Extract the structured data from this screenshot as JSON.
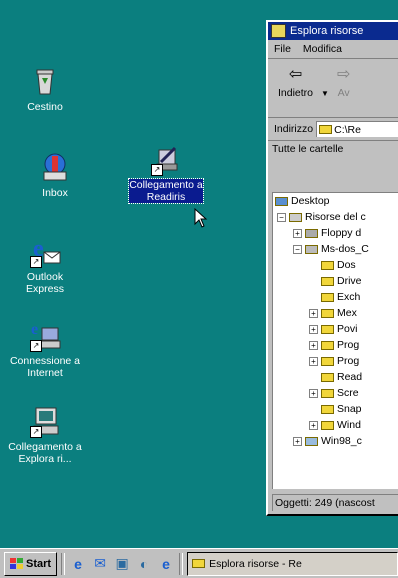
{
  "desktop": {
    "icons": [
      {
        "label": "Cestino"
      },
      {
        "label": "Inbox"
      },
      {
        "label": "Outlook Express"
      },
      {
        "label": "Connessione a Internet"
      },
      {
        "label": "Collegamento a Explora ri..."
      },
      {
        "label": "Collegamento a Readiris"
      }
    ]
  },
  "explorer": {
    "title": "Esplora risorse",
    "menu": [
      "File",
      "Modifica"
    ],
    "toolbar": {
      "back": "Indietro",
      "forward": "Av"
    },
    "address": {
      "label": "Indirizzo",
      "value": "C:\\Re"
    },
    "pane_header": "Tutte le cartelle",
    "tree": [
      "Desktop",
      "Risorse del c",
      "Floppy d",
      "Ms-dos_C",
      "Dos",
      "Drive",
      "Exch",
      "Mex",
      "Povi",
      "Prog",
      "Prog",
      "Read",
      "Scre",
      "Snap",
      "Wind",
      "Win98_c"
    ],
    "status": "Oggetti: 249 (nascost"
  },
  "taskbar": {
    "start": "Start",
    "task": "Esplora risorse - Re"
  }
}
